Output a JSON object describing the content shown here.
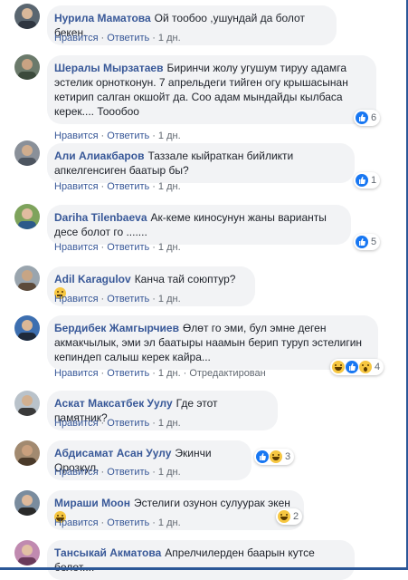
{
  "colors": {
    "link": "#385898",
    "bubble": "#f2f3f5",
    "like": "#1877f2",
    "frame": "#2b5797"
  },
  "actions": {
    "like": "Нравится",
    "reply": "Ответить",
    "time": "1 дн.",
    "edited": "Отредактирован"
  },
  "comments": [
    {
      "author": "Нурила Маматова",
      "text": "Ой тообоо ,ушундай да болот бекен.",
      "avatar": "avatar-photo"
    },
    {
      "author": "Шералы Мырзатаев",
      "text": "Биринчи жолу угушум тируу адамга эстелик орнотконун. 7 апрельдеги тийген огу крышасынан кетирип салган окшойт да. Соо адам мындайды кылбаса керек.... Тоообоо",
      "avatar": "avatar-photo",
      "reactions": [
        {
          "icon": "like-icon",
          "count": "6"
        }
      ]
    },
    {
      "author": "Али Алиакбаров",
      "text": "Таззале кыйраткан бийликти апкелгенсиген баатыр бы?",
      "avatar": "avatar-photo",
      "reactions": [
        {
          "icon": "like-icon",
          "count": "1"
        }
      ]
    },
    {
      "author": "Dariha Tilenbaeva",
      "text": "Ак-кеме киносунун жаны варианты десе болот го .......",
      "avatar": "avatar-photo",
      "reactions": [
        {
          "icon": "like-icon",
          "count": "5"
        }
      ]
    },
    {
      "author": "Adil Karagulov",
      "text": "Канча тай союптур?",
      "avatar": "avatar-photo",
      "emoji": "thinking-emoji"
    },
    {
      "author": "Бердибек Жамгырчиев",
      "text": "Өлөт го эми, бул эмне деген акмакчылык, эми эл баатыры наамын берип туруп эстелигин кепиндеп салыш керек кайра...",
      "avatar": "avatar-photo",
      "reactions": [
        {
          "icon": "haha-icon"
        },
        {
          "icon": "like-icon"
        },
        {
          "icon": "wow-icon",
          "count": "4"
        }
      ],
      "edited": true
    },
    {
      "author": "Аскат Максатбек Уулу",
      "text": "Где этот памятник?",
      "avatar": "avatar-photo"
    },
    {
      "author": "Абдисамат Асан Уулу",
      "text": "Экинчи Орозкул.",
      "avatar": "avatar-photo",
      "reactions": [
        {
          "icon": "like-icon"
        },
        {
          "icon": "haha-icon",
          "count": "3"
        }
      ]
    },
    {
      "author": "Мираши Моон",
      "text": "Эстелиги озунон сулуурак экен",
      "avatar": "avatar-photo",
      "emoji": "laughing-emoji",
      "reactions": [
        {
          "icon": "haha-icon",
          "count": "2"
        }
      ]
    },
    {
      "author": "Тансыкай Акматова",
      "text": "Апрелчилерден баарын кутсе болот....",
      "avatar": "avatar-photo"
    }
  ]
}
